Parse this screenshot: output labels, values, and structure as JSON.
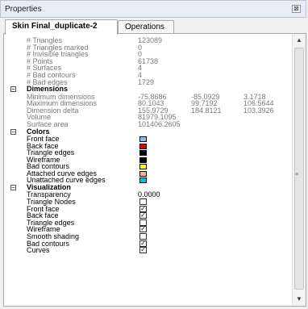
{
  "window": {
    "title": "Properties",
    "close_glyph": "⊠"
  },
  "tabs": [
    {
      "label": "Skin Final_duplicate-2",
      "active": true
    },
    {
      "label": "Operations",
      "active": false
    }
  ],
  "stats": [
    {
      "label": "# Triangles",
      "value": "123089"
    },
    {
      "label": "# Triangles marked",
      "value": "0"
    },
    {
      "label": "# Invisible triangles",
      "value": "0"
    },
    {
      "label": "# Points",
      "value": "61738"
    },
    {
      "label": "# Surfaces",
      "value": "4"
    },
    {
      "label": "# Bad contours",
      "value": "4"
    },
    {
      "label": "# Bad edges",
      "value": "1729"
    }
  ],
  "dimensions": {
    "title": "Dimensions",
    "rows": [
      {
        "label": "Minimum dimensions",
        "values": [
          "-75.8686",
          "-85.0929",
          "3.1718"
        ]
      },
      {
        "label": "Maximum dimensions",
        "values": [
          "80.1043",
          "99.7192",
          "106.5644"
        ]
      },
      {
        "label": "Dimension delta",
        "values": [
          "155.9729",
          "184.8121",
          "103.3926"
        ]
      },
      {
        "label": "Volume",
        "values": [
          "81979.1095"
        ]
      },
      {
        "label": "Surface area",
        "values": [
          "101406.2605"
        ]
      }
    ]
  },
  "colors": {
    "title": "Colors",
    "rows": [
      {
        "label": "Front face",
        "color": "#7ec0ee"
      },
      {
        "label": "Back face",
        "color": "#e00000"
      },
      {
        "label": "Triangle edges",
        "color": "#000000"
      },
      {
        "label": "Wireframe",
        "color": "#000000"
      },
      {
        "label": "Bad contours",
        "color": "#ffff00"
      },
      {
        "label": "Attached curve edges",
        "color": "#ffb07a"
      },
      {
        "label": "Unattached curve edges",
        "color": "#00c8d8"
      }
    ]
  },
  "visualization": {
    "title": "Visualization",
    "transparency_label": "Transparency",
    "transparency_value": "0.0000",
    "rows": [
      {
        "label": "Triangle Nodes",
        "checked": false
      },
      {
        "label": "Front face",
        "checked": true
      },
      {
        "label": "Back face",
        "checked": true
      },
      {
        "label": "Triangle edges",
        "checked": false
      },
      {
        "label": "Wireframe",
        "checked": true
      },
      {
        "label": "Smooth shading",
        "checked": false
      },
      {
        "label": "Bad contours",
        "checked": true
      },
      {
        "label": "Curves",
        "checked": true
      }
    ]
  },
  "scrollbar": {
    "up_glyph": "▲",
    "down_glyph": "▼",
    "grip_glyph": "≡"
  },
  "section_toggle_glyph": "−",
  "check_glyph": "✓"
}
